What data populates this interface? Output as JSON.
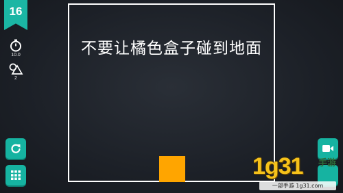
{
  "hud": {
    "level": "16",
    "timer_icon": "stopwatch-icon",
    "timer_value": "10.0",
    "shapes_icon": "shapes-icon",
    "shapes_count": "2"
  },
  "buttons": {
    "restart_icon": "restart-icon",
    "menu_icon": "grid-menu-icon",
    "video_icon": "video-camera-icon"
  },
  "arena": {
    "instruction": "不要让橘色盒子碰到地面"
  },
  "colors": {
    "accent": "#16b3a1",
    "box": "#ffa500",
    "background": "#1c2027",
    "border": "#ffffff"
  },
  "watermark": {
    "digits": "1g31",
    "subtitle": "一部手游 1g31.com",
    "brand": "手游"
  }
}
